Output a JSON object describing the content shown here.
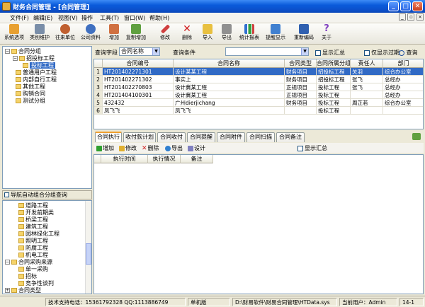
{
  "window": {
    "title": "财务合同管理 - [合同管理]",
    "minimize": "_",
    "maximize": "□",
    "close": "✕"
  },
  "menu": [
    "文件(F)",
    "编辑(E)",
    "视图(V)",
    "操作",
    "工具(T)",
    "窗口(W)",
    "帮助(H)"
  ],
  "toolbar": [
    "系统选项",
    "类别维护",
    "往来单位",
    "公司资料",
    "增加",
    "复制增加",
    "修改",
    "删除",
    "导入",
    "导出",
    "统计报表",
    "提醒显示",
    "重新编码",
    "关于"
  ],
  "tree1": [
    {
      "label": "合同分组",
      "level": 0,
      "expander": "−"
    },
    {
      "label": "招投标工程",
      "level": 1,
      "expander": "−"
    },
    {
      "label": "投标工程",
      "level": 2,
      "expander": ""
    },
    {
      "label": "普通用户工程",
      "level": 1,
      "expander": ""
    },
    {
      "label": "内部自行工程",
      "level": 1,
      "expander": ""
    },
    {
      "label": "其他工程",
      "level": 1,
      "expander": ""
    },
    {
      "label": "购销合同",
      "level": 1,
      "expander": ""
    },
    {
      "label": "测试分组",
      "level": 1,
      "expander": ""
    }
  ],
  "nav_label": "导航自动组合分组查询",
  "tree2": [
    {
      "label": "道路工程",
      "level": 2
    },
    {
      "label": "开发前期类",
      "level": 2
    },
    {
      "label": "桥梁工程",
      "level": 2
    },
    {
      "label": "建筑工程",
      "level": 2
    },
    {
      "label": "园林绿化工程",
      "level": 2
    },
    {
      "label": "照明工程",
      "level": 2
    },
    {
      "label": "防腐工程",
      "level": 2
    },
    {
      "label": "机电工程",
      "level": 2
    },
    {
      "label": "合同采购来源",
      "level": 0
    },
    {
      "label": "单一采购",
      "level": 2
    },
    {
      "label": "招标",
      "level": 2
    },
    {
      "label": "竞争性谈判",
      "level": 2
    },
    {
      "label": "合同类型",
      "level": 0
    }
  ],
  "query": {
    "field_label": "查询字段",
    "field_value": "合同名称",
    "cond_label": "查询条件",
    "cond_value": "",
    "show_summary": "显示汇总",
    "show_expired": "仅显示过期",
    "query_btn": "查询"
  },
  "grid": {
    "columns": [
      "合同编号",
      "合同名称",
      "合同类型",
      "合同所属分组",
      "责任人",
      "部门"
    ],
    "rows": [
      {
        "no": "1",
        "cells": [
          "HT201402271301",
          "设计某某工程",
          "财务项目",
          "招投标工程",
          "关羽",
          "综合办公室"
        ],
        "selected": true
      },
      {
        "no": "2",
        "cells": [
          "HT201402271302",
          "事实上",
          "财务项目",
          "招投标工程",
          "张飞",
          "总经办"
        ]
      },
      {
        "no": "3",
        "cells": [
          "HT201402270803",
          "设计冀某工程",
          "正规项目",
          "投标工程",
          "张飞",
          "总经办"
        ]
      },
      {
        "no": "4",
        "cells": [
          "HT201404100301",
          "设计冀某工程",
          "正规项目",
          "投标工程",
          "",
          "总经办"
        ]
      },
      {
        "no": "5",
        "cells": [
          "432432",
          "广州dierjichang",
          "财务项目",
          "投标工程",
          "周芷若",
          "综合办公室"
        ]
      },
      {
        "no": "6",
        "cells": [
          "凤飞飞",
          "凤飞飞",
          "",
          "投标工程",
          "",
          ""
        ]
      }
    ]
  },
  "tabs": [
    "合同执行",
    "收付款计划",
    "合同收付",
    "合同提醒",
    "合同附件",
    "合同扫描",
    "合同备注"
  ],
  "subtoolbar": {
    "add": "增加",
    "edit": "修改",
    "del": "删除",
    "export": "导出",
    "design": "设计",
    "summary": "显示汇总"
  },
  "subgrid_columns": [
    "执行时间",
    "执行情况",
    "备注"
  ],
  "status": {
    "support": "技术支持电话：15361792328 QQ:1113886749",
    "version": "单机版",
    "path": "D:\\财易软件\\财易合同管理\\HTData.sys",
    "user": "当前用户：Admin",
    "page": "14-1"
  },
  "colors": {
    "title_bar": "#0A5BDB",
    "selected_row": "#316AC5",
    "tab_accent": "#F0A030"
  }
}
